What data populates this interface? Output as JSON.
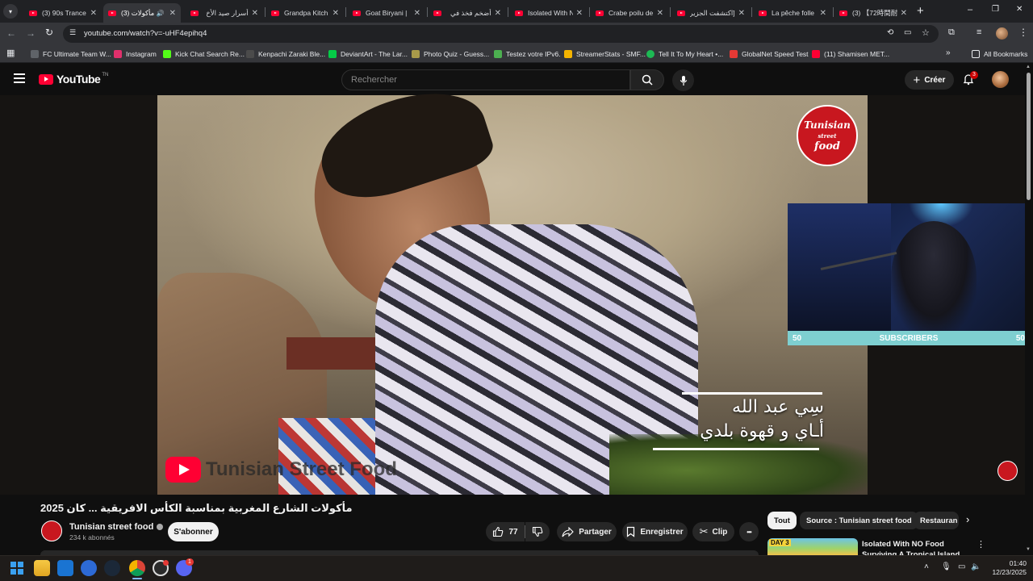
{
  "browser": {
    "tabs": [
      {
        "title": "(3) 90s Trance"
      },
      {
        "title": "(3) مأكولات",
        "active": true
      },
      {
        "title": "أسرار صيد الأخ"
      },
      {
        "title": "Grandpa Kitch"
      },
      {
        "title": "Goat Biryani |"
      },
      {
        "title": "أضخم فخذ في"
      },
      {
        "title": "Isolated With N"
      },
      {
        "title": "Crabe poilu de"
      },
      {
        "title": "[اكتشفت الجزير"
      },
      {
        "title": "La pêche folle"
      },
      {
        "title": "(3) 【72時間耐"
      }
    ],
    "new_tab_label": "+",
    "window_controls": [
      "–",
      "❐",
      "✕"
    ],
    "url": "youtube.com/watch?v=-uHF4epihq4",
    "bookmarks": [
      {
        "label": "FC Ultimate Team W...",
        "color": "#5f6368"
      },
      {
        "label": "Instagram",
        "color": "#e1306c"
      },
      {
        "label": "Kick Chat Search Re...",
        "color": "#53fc18"
      },
      {
        "label": "Kenpachi Zaraki Ble...",
        "color": "#4b4b4b"
      },
      {
        "label": "DeviantArt - The Lar...",
        "color": "#05cc47"
      },
      {
        "label": "Photo Quiz - Guess...",
        "color": "#a89a4a"
      },
      {
        "label": "Testez votre IPv6.",
        "color": "#4caf50"
      },
      {
        "label": "StreamerStats - SMF...",
        "color": "#f4b400"
      },
      {
        "label": "Tell It To My Heart •...",
        "color": "#1db954"
      },
      {
        "label": "GlobalNet Speed Test",
        "color": "#e53935"
      },
      {
        "label": "(11) Shamisen MET...",
        "color": "#ff0033"
      }
    ],
    "all_bookmarks_label": "All Bookmarks"
  },
  "youtube": {
    "logo_text": "YouTube",
    "logo_region": "TN",
    "search_placeholder": "Rechercher",
    "create_label": "Créer",
    "notification_count": "3",
    "accent": "#ff0033"
  },
  "video": {
    "channel_logo_text": [
      "Tunisian",
      "street",
      "food"
    ],
    "watermark": "Tunisian Street Food",
    "caption_line1": "سِي عبد الله",
    "caption_line2": "أـاي و قهوة بلدي",
    "overlay_subscribers_left": "50",
    "overlay_subscribers_label": "SUBSCRIBERS",
    "overlay_subscribers_right": "50"
  },
  "meta": {
    "title": "مأكولات الشارع المغربية بمناسبة الكأس الافريقية ... كان 2025",
    "channel_name": "Tunisian street food",
    "subscribers": "234 k abonnés",
    "subscribe_label": "S'abonner",
    "likes": "77",
    "share_label": "Partager",
    "save_label": "Enregistrer",
    "clip_label": "Clip",
    "more_label": "•••"
  },
  "chips": {
    "items": [
      "Tout",
      "Source : Tunisian street food",
      "Restauran"
    ]
  },
  "recommendation": {
    "badge": "DAY 3",
    "title": "Isolated With NO Food Surviving A Tropical Island"
  },
  "taskbar": {
    "time": "01:40",
    "date": "12/23/2025",
    "discord_badge": "1"
  }
}
